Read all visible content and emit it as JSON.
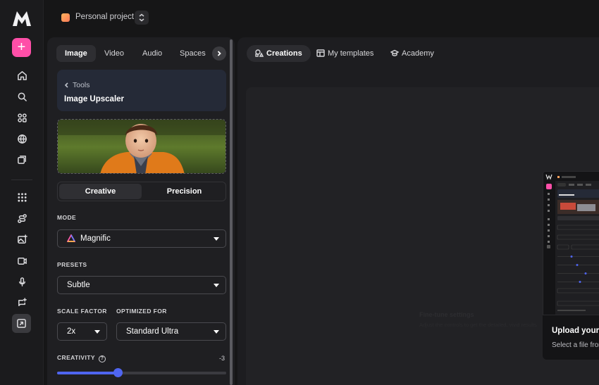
{
  "project": {
    "name": "Personal project"
  },
  "panel": {
    "tabs": [
      "Image",
      "Video",
      "Audio",
      "Spaces"
    ],
    "tool": {
      "back_label": "Tools",
      "name": "Image Upscaler"
    },
    "segments": [
      "Creative",
      "Precision"
    ],
    "mode": {
      "label": "MODE",
      "value": "Magnific"
    },
    "presets": {
      "label": "PRESETS",
      "value": "Subtle"
    },
    "scale": {
      "label": "SCALE FACTOR",
      "value": "2x"
    },
    "optimized": {
      "label": "OPTIMIZED FOR",
      "value": "Standard Ultra"
    },
    "creativity": {
      "label": "CREATIVITY",
      "value": "-3",
      "help": "?",
      "slider_fraction": 0.36
    }
  },
  "main": {
    "tabs": [
      "Creations",
      "My templates",
      "Academy"
    ],
    "ghost_title": "Fine-tune settings",
    "ghost_sub": "Adjust the controls to get the detailed, vivid results",
    "upload": {
      "title": "Upload your image",
      "subtitle": "Select a file from your device"
    }
  },
  "colors": {
    "accent": "#4f65f0",
    "new_button": "#ff4fa8",
    "tool_card": "#252a37"
  }
}
